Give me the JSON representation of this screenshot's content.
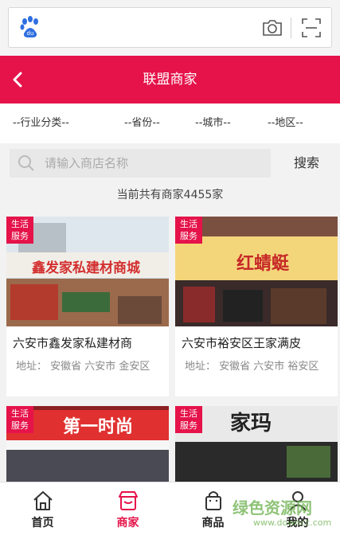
{
  "header": {
    "title": "联盟商家"
  },
  "filters": {
    "category": "--行业分类--",
    "province": "--省份--",
    "city": "--城市--",
    "district": "--地区--"
  },
  "search": {
    "placeholder": "请输入商店名称",
    "button": "搜索"
  },
  "count_text": "当前共有商家4455家",
  "badge": "生活服务",
  "stores": [
    {
      "name": "六安市鑫发家私建材商",
      "address": "地址： 安徽省 六安市 金安区",
      "sign": "鑫发家私建材商城",
      "sign_color": "#d32f2f"
    },
    {
      "name": "六安市裕安区王家满皮",
      "address": "地址： 安徽省 六安市 裕安区",
      "sign": "红蜻蜓",
      "sign_color": "#c62828"
    },
    {
      "name": "",
      "address": "",
      "sign": "第一时尚",
      "sign_color": "#c62828"
    },
    {
      "name": "",
      "address": "",
      "sign": "家玛",
      "sign_color": "#222222"
    }
  ],
  "tabs": [
    {
      "label": "首页",
      "icon": "home-icon"
    },
    {
      "label": "商家",
      "icon": "store-icon"
    },
    {
      "label": "商品",
      "icon": "bag-icon"
    },
    {
      "label": "我的",
      "icon": "user-icon"
    }
  ],
  "watermark": {
    "text": "绿色资源网",
    "sub": "www.downcc.com"
  },
  "colors": {
    "accent": "#e5134a",
    "badge": "#e5134a"
  }
}
